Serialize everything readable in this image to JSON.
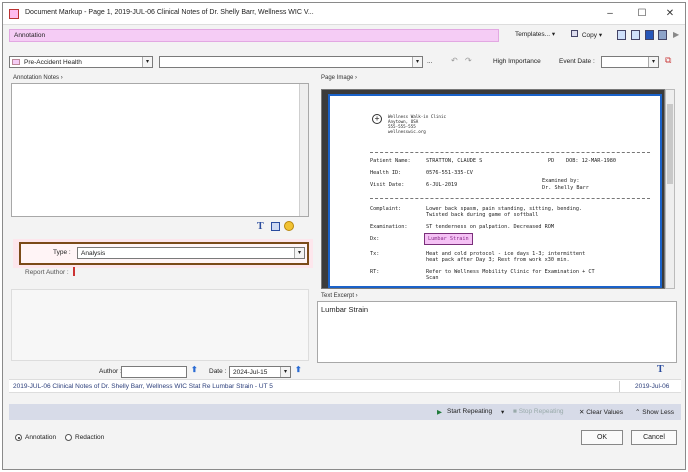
{
  "window": {
    "title": "Document Markup - Page 1, 2019-JUL-06 Clinical Notes of Dr. Shelly Barr, Wellness WIC V...",
    "minimize": "–",
    "maximize": "☐",
    "close": "✕"
  },
  "toolbar": {
    "annotation_label": "Annotation",
    "templates_label": "Templates...",
    "copy_label": "Copy",
    "category_value": "Pre-Accident Health",
    "description_value": "",
    "ellipsis": "...",
    "high_importance_label": "High Importance",
    "event_date_label": "Event Date :",
    "event_date_value": ""
  },
  "left": {
    "annotation_notes_label": "Annotation Notes",
    "type_label": "Type :",
    "type_value": "Analysis",
    "report_author_label": "Report Author :",
    "author_label": "Author :",
    "author_value": "",
    "date_label": "Date :",
    "date_value": "2024-Jul-15"
  },
  "right": {
    "page_image_label": "Page Image",
    "text_excerpt_label": "Text Excerpt",
    "text_excerpt_value": "Lumbar Strain"
  },
  "document": {
    "clinic_lines": [
      "Wellness Walk-in Clinic",
      "Anytown, USA",
      "555-555-555",
      "wellnesswic.org"
    ],
    "patient_name_label": "Patient Name:",
    "patient_name_value": "STRATTON, CLAUDE S",
    "health_id_label": "Health ID:",
    "health_id_value": "0576-551-335-CV",
    "visit_date_label": "Visit Date:",
    "visit_date_value": "6-JUL-2019",
    "pd_label": "PD",
    "dob_value": "DOB: 12-MAR-1980",
    "examined_by": "Examined by:",
    "doctor": "Dr. Shelly Barr",
    "complaint_label": "Complaint:",
    "complaint_line1": "Lower back spasm, pain standing, sitting, bending.",
    "complaint_line2": "Twisted back during game of softball",
    "examination_label": "Examination:",
    "examination_value": "ST tenderness on palpation. Decreased ROM",
    "dx_label": "Dx:",
    "dx_value": "Lumbar Strain",
    "tx_label": "Tx:",
    "tx_line1": "Heat and cold protocol - ice days 1-3; intermittent",
    "tx_line2": "heat pack after Day 3; Rest from work x30 min.",
    "rt_label": "RT:",
    "rt_line1": "Refer to Wellness Mobility Clinic for Examination + CT",
    "rt_line2": "Scan"
  },
  "status": {
    "left_text": "2019-JUL-06 Clinical Notes of Dr. Shelly Barr, Wellness WIC Stat Re Lumbar Strain - UT 5",
    "right_text": "2019-Jul-06"
  },
  "actions": {
    "start_repeating": "Start Repeating",
    "stop_repeating": "Stop Repeating",
    "clear_values": "Clear Values",
    "show_less": "Show Less"
  },
  "footer": {
    "annotation_radio": "Annotation",
    "redaction_radio": "Redaction",
    "ok": "OK",
    "cancel": "Cancel"
  },
  "colors": {
    "annotation_bar": "#f5ccf5",
    "type_frame": "#7b4a18",
    "page_border": "#1a62c9",
    "action_bar": "#d7dbe8"
  }
}
